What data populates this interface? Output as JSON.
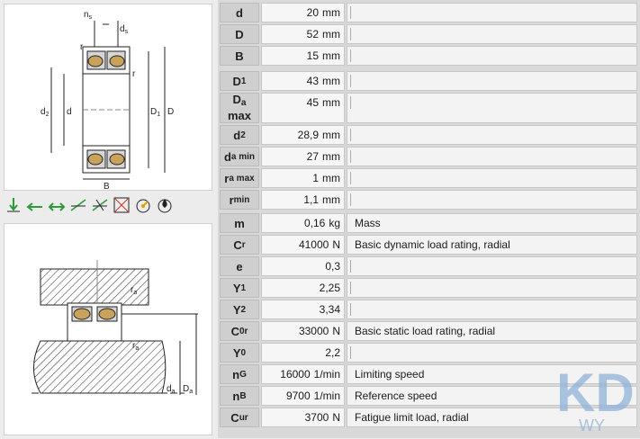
{
  "drawing_labels": {
    "ns": "n",
    "ns_sub": "s",
    "ds": "d",
    "ds_sub": "s",
    "r_top": "r",
    "r_right": "r",
    "d2": "d",
    "d2_sub": "2",
    "d": "d",
    "D1": "D",
    "D1_sub": "1",
    "D": "D",
    "B": "B",
    "ra_top": "r",
    "ra_top_sub": "a",
    "ra_bottom": "r",
    "ra_bottom_sub": "a",
    "da": "d",
    "da_sub": "a",
    "Da": "D",
    "Da_sub": "a"
  },
  "load_icons": [
    {
      "name": "radial-load-icon",
      "label": "F",
      "sub": "r"
    },
    {
      "name": "axial-load-icon",
      "label": "F",
      "sub": "a"
    },
    {
      "name": "bidirectional-axial-load-icon",
      "label": "F",
      "sub": "a"
    },
    {
      "name": "misalignment-icon",
      "label": ""
    },
    {
      "name": "angular-misalignment-icon",
      "label": ""
    },
    {
      "name": "locating-bearing-icon",
      "label": ""
    },
    {
      "name": "high-speed-icon",
      "label": ""
    },
    {
      "name": "lubrication-icon",
      "label": ""
    }
  ],
  "groups": [
    {
      "rows": [
        {
          "label": "d",
          "sub": "",
          "value": "20",
          "unit": "mm",
          "desc": ""
        },
        {
          "label": "D",
          "sub": "",
          "value": "52",
          "unit": "mm",
          "desc": ""
        },
        {
          "label": "B",
          "sub": "",
          "value": "15",
          "unit": "mm",
          "desc": ""
        }
      ]
    },
    {
      "rows": [
        {
          "label": "D",
          "sub": "1",
          "value": "43",
          "unit": "mm",
          "desc": ""
        },
        {
          "label": "D",
          "sub": "a",
          "label2": "max",
          "value": "45",
          "unit": "mm",
          "desc": ""
        },
        {
          "label": "d",
          "sub": "2",
          "value": "28,9",
          "unit": "mm",
          "desc": ""
        },
        {
          "label": "d",
          "sub": "a min",
          "value": "27",
          "unit": "mm",
          "desc": ""
        },
        {
          "label": "r",
          "sub": "a max",
          "value": "1",
          "unit": "mm",
          "desc": ""
        },
        {
          "label": "r",
          "sub": "min",
          "value": "1,1",
          "unit": "mm",
          "desc": ""
        }
      ]
    },
    {
      "rows": [
        {
          "label": "m",
          "sub": "",
          "value": "0,16",
          "unit": "kg",
          "desc": "Mass"
        },
        {
          "label": "C",
          "sub": "r",
          "value": "41000",
          "unit": "N",
          "desc": "Basic dynamic load rating, radial"
        },
        {
          "label": "e",
          "sub": "",
          "value": "0,3",
          "unit": "",
          "desc": ""
        },
        {
          "label": "Y",
          "sub": "1",
          "value": "2,25",
          "unit": "",
          "desc": ""
        },
        {
          "label": "Y",
          "sub": "2",
          "value": "3,34",
          "unit": "",
          "desc": ""
        },
        {
          "label": "C",
          "sub": "0r",
          "value": "33000",
          "unit": "N",
          "desc": "Basic static load rating, radial"
        },
        {
          "label": "Y",
          "sub": "0",
          "value": "2,2",
          "unit": "",
          "desc": ""
        },
        {
          "label": "n",
          "sub": "G",
          "value": "16000",
          "unit": "1/min",
          "desc": "Limiting speed"
        },
        {
          "label": "n",
          "sub": "B",
          "value": "9700",
          "unit": "1/min",
          "desc": "Reference speed"
        },
        {
          "label": "C",
          "sub": "ur",
          "value": "3700",
          "unit": "N",
          "desc": "Fatigue limit load, radial"
        }
      ]
    }
  ],
  "watermark": {
    "text": "KD",
    "sub": "WY"
  },
  "colors": {
    "accent_blue": "#8fb3d9",
    "green_arrow": "#2e9a3a",
    "hatch": "#333333"
  }
}
